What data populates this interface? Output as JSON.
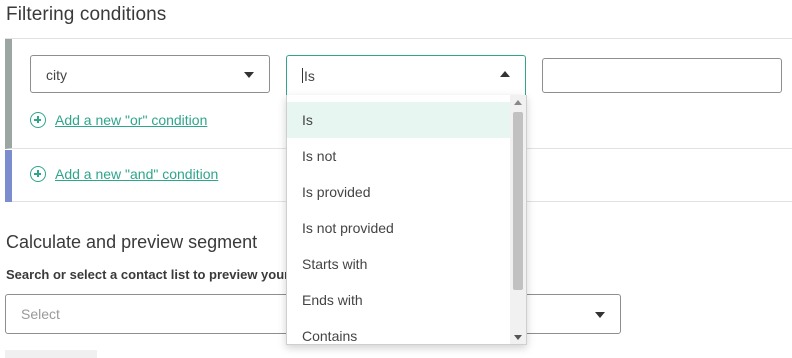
{
  "filtering": {
    "title": "Filtering conditions",
    "field_select": {
      "value": "city",
      "icon": "chevron-down-icon"
    },
    "operator_select": {
      "value": "Is",
      "icon": "chevron-up-icon",
      "open": true
    },
    "value_input": {
      "value": "",
      "placeholder": ""
    },
    "add_or_label": "Add a new \"or\" condition",
    "add_and_label": "Add a new \"and\" condition",
    "icons": {
      "add": "plus-circle-icon"
    }
  },
  "dropdown": {
    "selected": "Is",
    "options": [
      "Is",
      "Is not",
      "Is provided",
      "Is not provided",
      "Starts with",
      "Ends with",
      "Contains"
    ]
  },
  "preview": {
    "title": "Calculate and preview segment",
    "label": "Search or select a contact list to preview your",
    "select_placeholder": "Select"
  },
  "colors": {
    "accent": "#2fa58c",
    "or_bar": "#9ba5a2",
    "and_bar": "#7b8ccf",
    "selected_option_bg": "#e8f6f2"
  }
}
